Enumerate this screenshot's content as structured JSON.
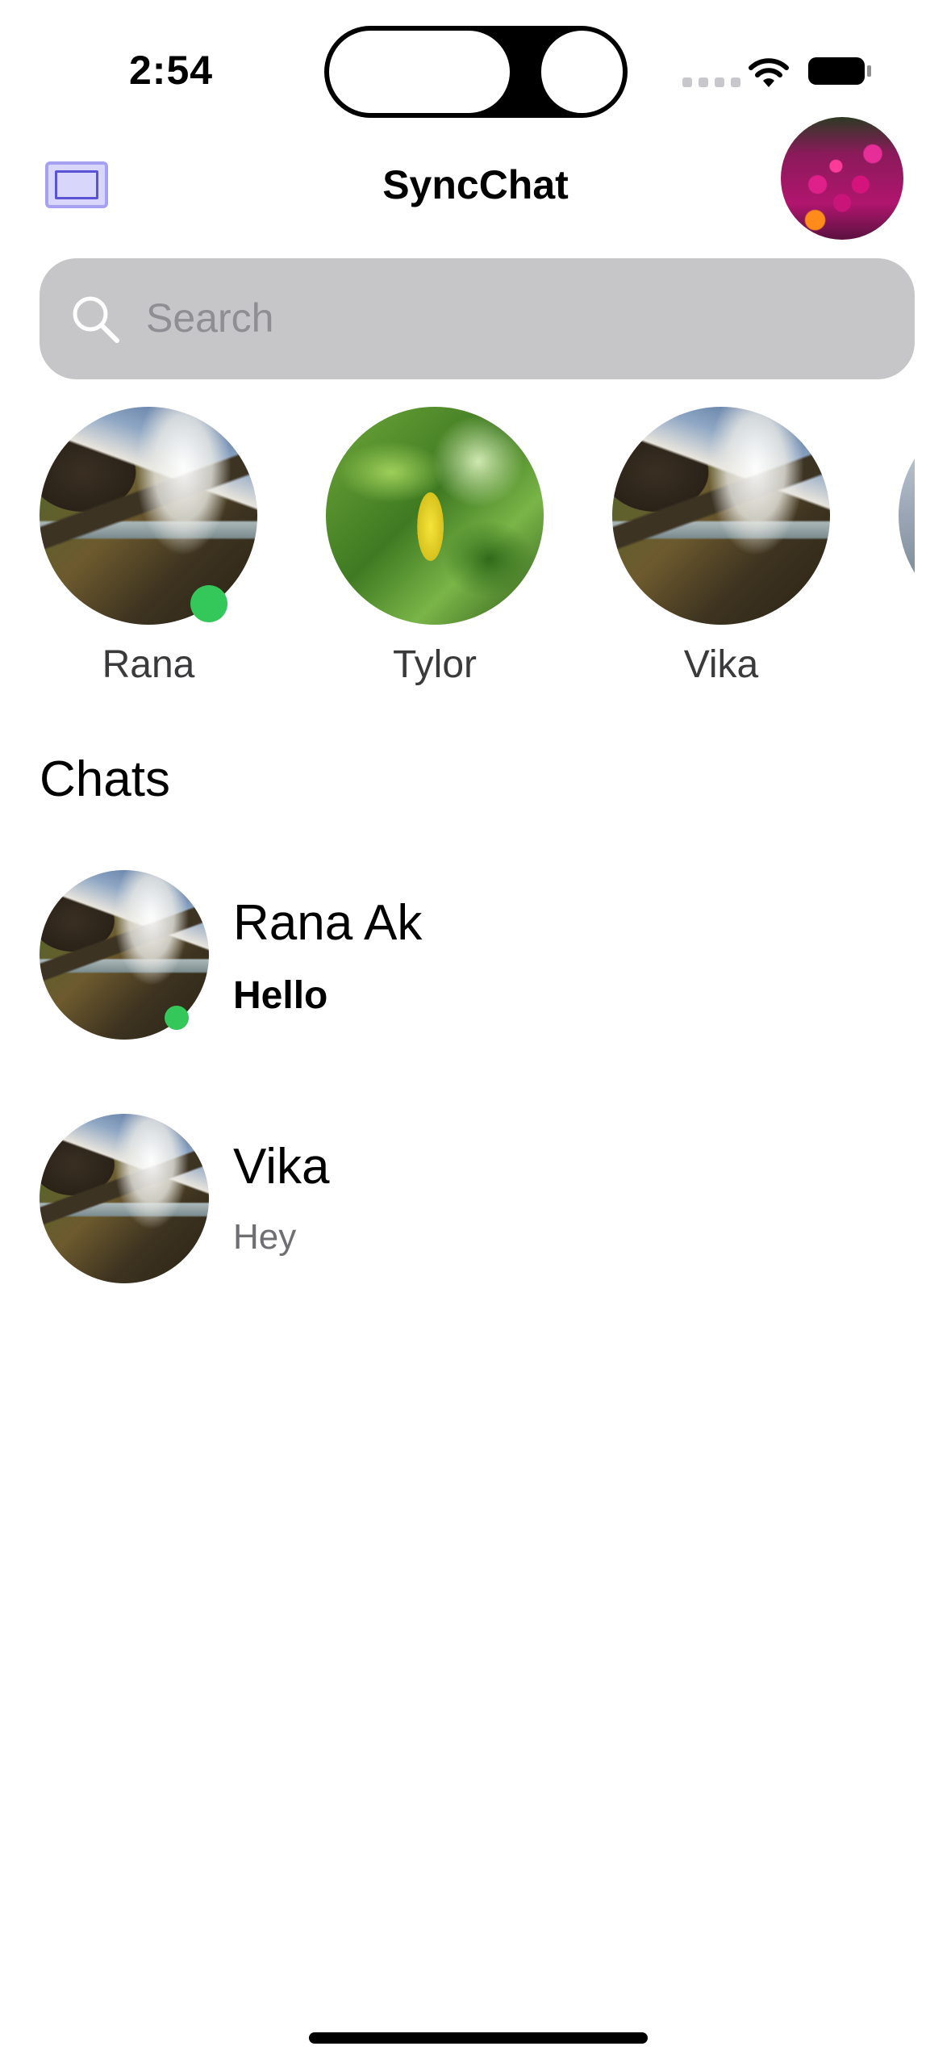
{
  "status_bar": {
    "time": "2:54"
  },
  "header": {
    "title": "SyncChat",
    "menu_icon": "sidebar-icon",
    "profile_avatar_image": "pink-flowers"
  },
  "search": {
    "placeholder": "Search",
    "value": ""
  },
  "stories": [
    {
      "name": "Rana",
      "image": "waterfall",
      "online": true
    },
    {
      "name": "Tylor",
      "image": "green-leaves",
      "online": false
    },
    {
      "name": "Vika",
      "image": "waterfall",
      "online": false
    }
  ],
  "chats_section": {
    "heading": "Chats",
    "items": [
      {
        "name": "Rana Ak",
        "preview": "Hello",
        "unread": true,
        "online": true,
        "image": "waterfall"
      },
      {
        "name": "Vika",
        "preview": "Hey",
        "unread": false,
        "online": false,
        "image": "waterfall"
      }
    ]
  },
  "colors": {
    "online": "#34c759",
    "search_bg": "#c6c6c8",
    "menu_accent": "#5c52d6"
  }
}
